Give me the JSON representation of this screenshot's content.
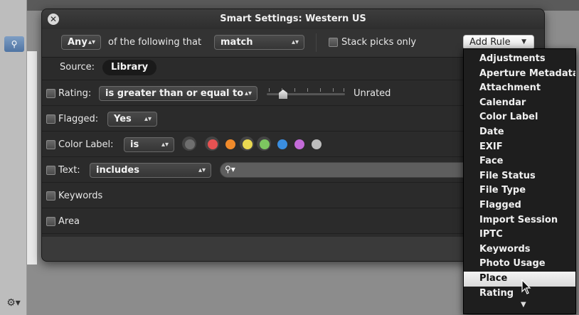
{
  "window": {
    "title": "Smart Settings: Western US"
  },
  "header": {
    "any_popup": "Any",
    "following_text": "of the following that",
    "match_popup": "match",
    "stack_picks_label": "Stack picks only",
    "add_rule_label": "Add Rule"
  },
  "source": {
    "label": "Source:",
    "value": "Library"
  },
  "rules": {
    "rating": {
      "label": "Rating:",
      "operator": "is greater than or equal to",
      "value_text": "Unrated"
    },
    "flagged": {
      "label": "Flagged:",
      "value": "Yes"
    },
    "color_label": {
      "label": "Color Label:",
      "operator": "is",
      "colors": [
        "#5a5a5a",
        "#e23b3b",
        "#f08a2a",
        "#e8d43a",
        "#6cc04a",
        "#3a8ee0",
        "#c36bd8",
        "#bdbdbd"
      ]
    },
    "text": {
      "label": "Text:",
      "operator": "includes",
      "search_icon": "search-icon"
    },
    "keywords": {
      "label": "Keywords"
    },
    "area": {
      "label": "Area"
    }
  },
  "menu": {
    "items": [
      "Adjustments",
      "Aperture Metadata",
      "Attachment",
      "Calendar",
      "Color Label",
      "Date",
      "EXIF",
      "Face",
      "File Status",
      "File Type",
      "Flagged",
      "Import Session",
      "IPTC",
      "Keywords",
      "Photo Usage",
      "Place",
      "Rating"
    ],
    "highlighted": "Place"
  }
}
